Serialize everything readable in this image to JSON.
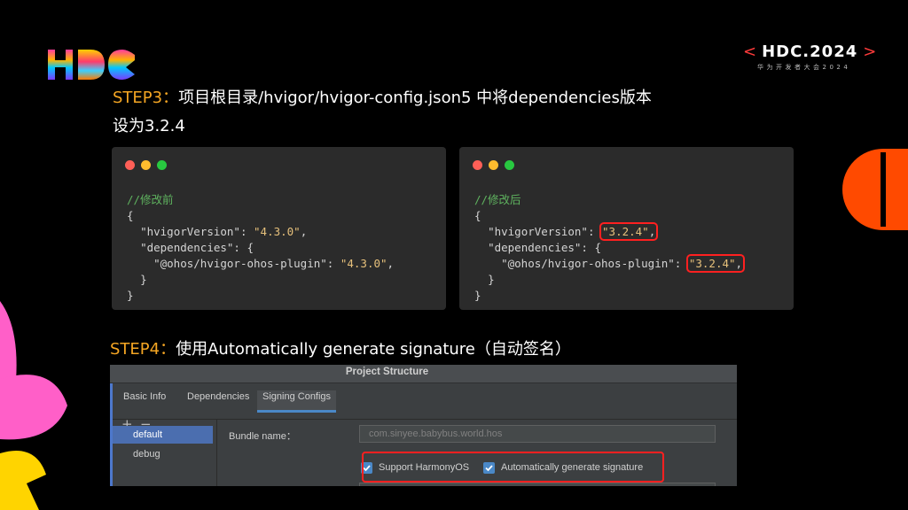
{
  "brand": {
    "logo_text": "HDC",
    "event_name": "HDC.2024",
    "event_sub": "华为开发者大会2024",
    "bracket_left": "<",
    "bracket_right": ">",
    "accent": "#ff3b3b"
  },
  "step3": {
    "tag": "STEP3：",
    "text": "项目根目录/hvigor/hvigor-config.json5 中将dependencies版本",
    "line2": "设为3.2.4"
  },
  "code_before": {
    "comment": "//修改前",
    "open_brace": "{",
    "line1_key": "\"hvigorVersion\"",
    "line1_sep": ": ",
    "line1_val": "\"4.3.0\"",
    "line1_end": ",",
    "line2_key": "\"dependencies\"",
    "line2_rest": ": {",
    "line3_key": "\"@ohos/hvigor-ohos-plugin\"",
    "line3_sep": ": ",
    "line3_val": "\"4.3.0\"",
    "line3_end": ",",
    "inner_close": "}",
    "close_brace": "}"
  },
  "code_after": {
    "comment": "//修改后",
    "open_brace": "{",
    "line1_key": "\"hvigorVersion\"",
    "line1_sep": ": ",
    "line1_val": "\"3.2.4\"",
    "line1_end": ",",
    "line2_key": "\"dependencies\"",
    "line2_rest": ": {",
    "line3_key": "\"@ohos/hvigor-ohos-plugin\"",
    "line3_sep": ": ",
    "line3_val": "\"3.2.4\"",
    "line3_end": ",",
    "inner_close": "}",
    "close_brace": "}"
  },
  "step4": {
    "tag": "STEP4：",
    "text": "使用Automatically generate signature（自动签名）"
  },
  "project_structure": {
    "title": "Project Structure",
    "tabs": [
      "Basic Info",
      "Dependencies",
      "Signing Configs"
    ],
    "active_tab": "Signing Configs",
    "add_tool": "+",
    "remove_tool": "−",
    "configs": [
      "default",
      "debug"
    ],
    "selected_config": "default",
    "bundle_label": "Bundle name：",
    "bundle_value": "com.sinyee.babybus.world.hos",
    "support_harmony_label": "Support HarmonyOS",
    "support_harmony_checked": true,
    "auto_sign_label": "Automatically generate signature",
    "auto_sign_checked": true
  },
  "colors": {
    "step_tag": "#f5a623",
    "highlight": "#ff2020",
    "code_string": "#e6c07b",
    "code_comment": "#5fb35f"
  }
}
